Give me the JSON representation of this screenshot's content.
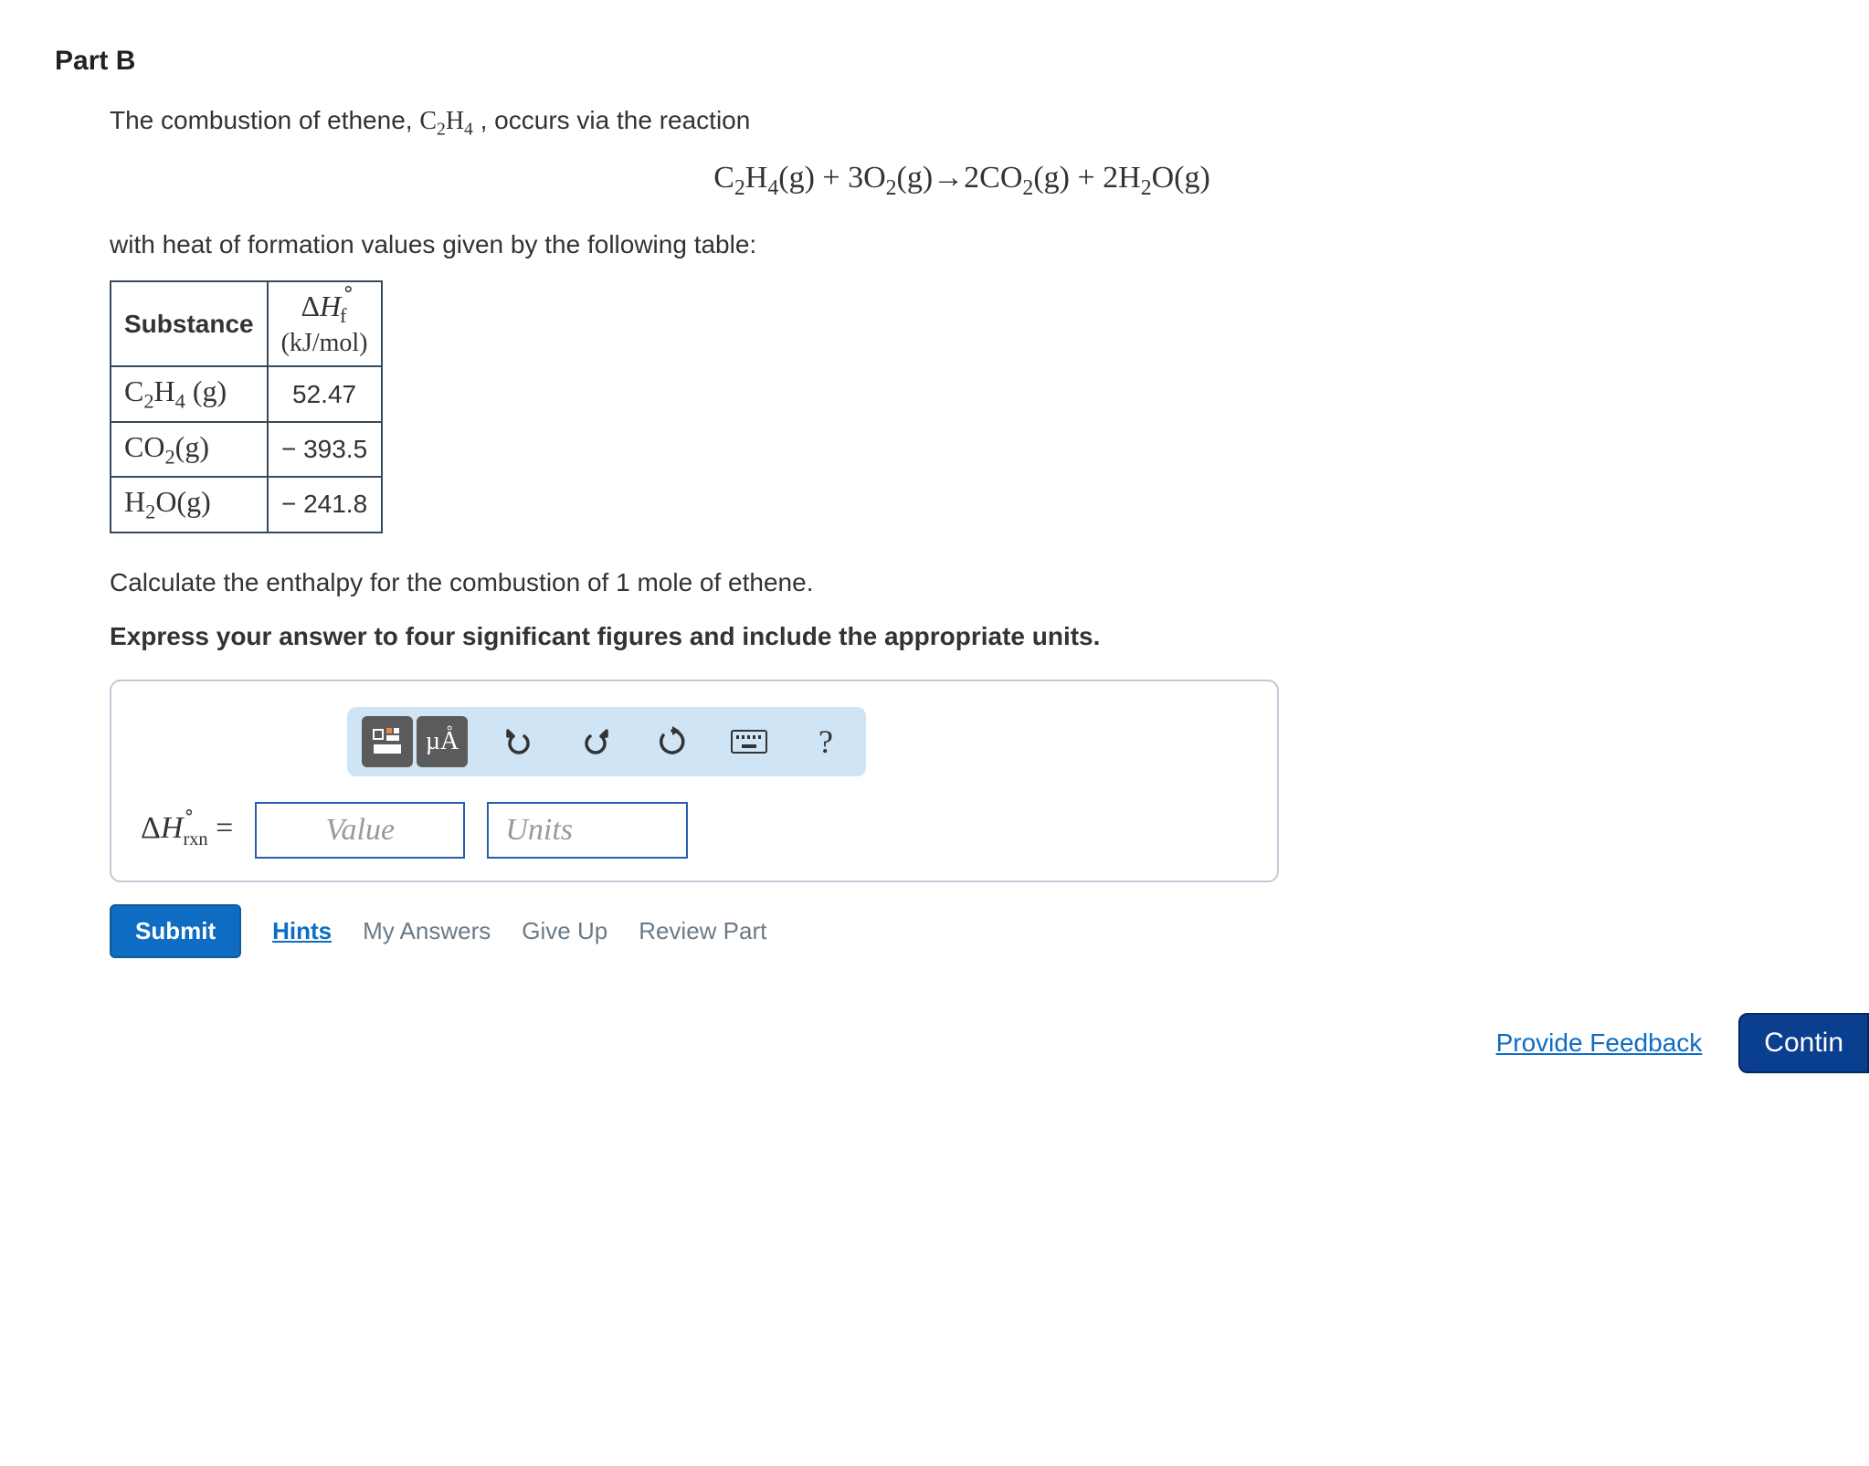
{
  "part_title": "Part B",
  "intro_text_1": "The combustion of ethene, ",
  "intro_formula": "C₂H₄",
  "intro_text_2": " , occurs via the reaction",
  "equation": "C₂H₄(g) + 3O₂(g)→2CO₂(g) + 2H₂O(g)",
  "table_intro": "with heat of formation values given by the following table:",
  "table": {
    "header_substance": "Substance",
    "header_delta": "ΔH∘f",
    "header_units": "(kJ/mol)",
    "rows": [
      {
        "substance": "C₂H₄ (g)",
        "value": "52.47"
      },
      {
        "substance": "CO₂(g)",
        "value": "− 393.5"
      },
      {
        "substance": "H₂O(g)",
        "value": "− 241.8"
      }
    ]
  },
  "calc_text": "Calculate the enthalpy for the combustion of 1 mole of ethene.",
  "express_text": "Express your answer to four significant figures and include the appropriate units.",
  "toolbar": {
    "templates_icon": "templates-icon",
    "units_icon": "µÅ",
    "undo_icon": "↶",
    "redo_icon": "↷",
    "reset_icon": "↻",
    "keyboard_icon": "keyboard",
    "help_icon": "?"
  },
  "answer": {
    "lhs": "ΔH∘rxn =",
    "value_placeholder": "Value",
    "units_placeholder": "Units"
  },
  "actions": {
    "submit": "Submit",
    "hints": "Hints",
    "my_answers": "My Answers",
    "give_up": "Give Up",
    "review_part": "Review Part"
  },
  "footer": {
    "feedback": "Provide Feedback",
    "continue": "Contin"
  }
}
